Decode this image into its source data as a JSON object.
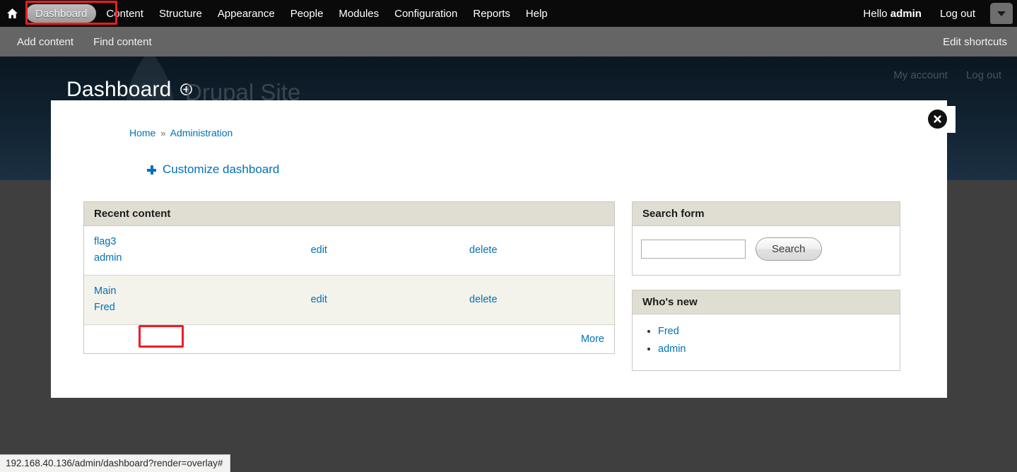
{
  "toolbar": {
    "home_icon": "home-icon",
    "items": [
      {
        "label": "Dashboard",
        "active": true
      },
      {
        "label": "Content",
        "active": false
      },
      {
        "label": "Structure",
        "active": false
      },
      {
        "label": "Appearance",
        "active": false
      },
      {
        "label": "People",
        "active": false
      },
      {
        "label": "Modules",
        "active": false
      },
      {
        "label": "Configuration",
        "active": false
      },
      {
        "label": "Reports",
        "active": false
      },
      {
        "label": "Help",
        "active": false
      }
    ],
    "greeting_prefix": "Hello ",
    "greeting_user": "admin",
    "logout_label": "Log out",
    "drawer_toggle_icon": "chevron-down-icon"
  },
  "shortcut_bar": {
    "items": [
      {
        "label": "Add content"
      },
      {
        "label": "Find content"
      }
    ],
    "edit_label": "Edit shortcuts"
  },
  "site_header": {
    "page_title": "Dashboard",
    "title_add_icon": "circle-plus-icon",
    "site_name": "Drupal Site",
    "user_links": [
      {
        "label": "My account"
      },
      {
        "label": "Log out"
      }
    ]
  },
  "overlay": {
    "close_icon": "close-icon",
    "breadcrumb": {
      "items": [
        {
          "label": "Home"
        },
        {
          "label": "Administration"
        }
      ],
      "separator": "»"
    },
    "customize_label": "Customize dashboard",
    "customize_icon": "plus-icon"
  },
  "recent_content": {
    "title": "Recent content",
    "rows": [
      {
        "node_title": "flag3",
        "author": "admin",
        "edit_label": "edit",
        "delete_label": "delete"
      },
      {
        "node_title": "Main",
        "author": "Fred",
        "edit_label": "edit",
        "delete_label": "delete"
      }
    ],
    "more_label": "More"
  },
  "search_block": {
    "title": "Search form",
    "input_value": "",
    "input_placeholder": "",
    "submit_label": "Search"
  },
  "whos_new": {
    "title": "Who's new",
    "users": [
      {
        "label": "Fred"
      },
      {
        "label": "admin"
      }
    ]
  },
  "status_bar": {
    "url": "192.168.40.136/admin/dashboard?render=overlay#"
  },
  "colors": {
    "toolbar_bg": "#0a0a0a",
    "shortcut_bg": "#656565",
    "link_blue": "#0071b3",
    "block_header": "#e0ded3",
    "annotation_red": "#ee1c25",
    "body_bg": "#3f3f3f"
  }
}
